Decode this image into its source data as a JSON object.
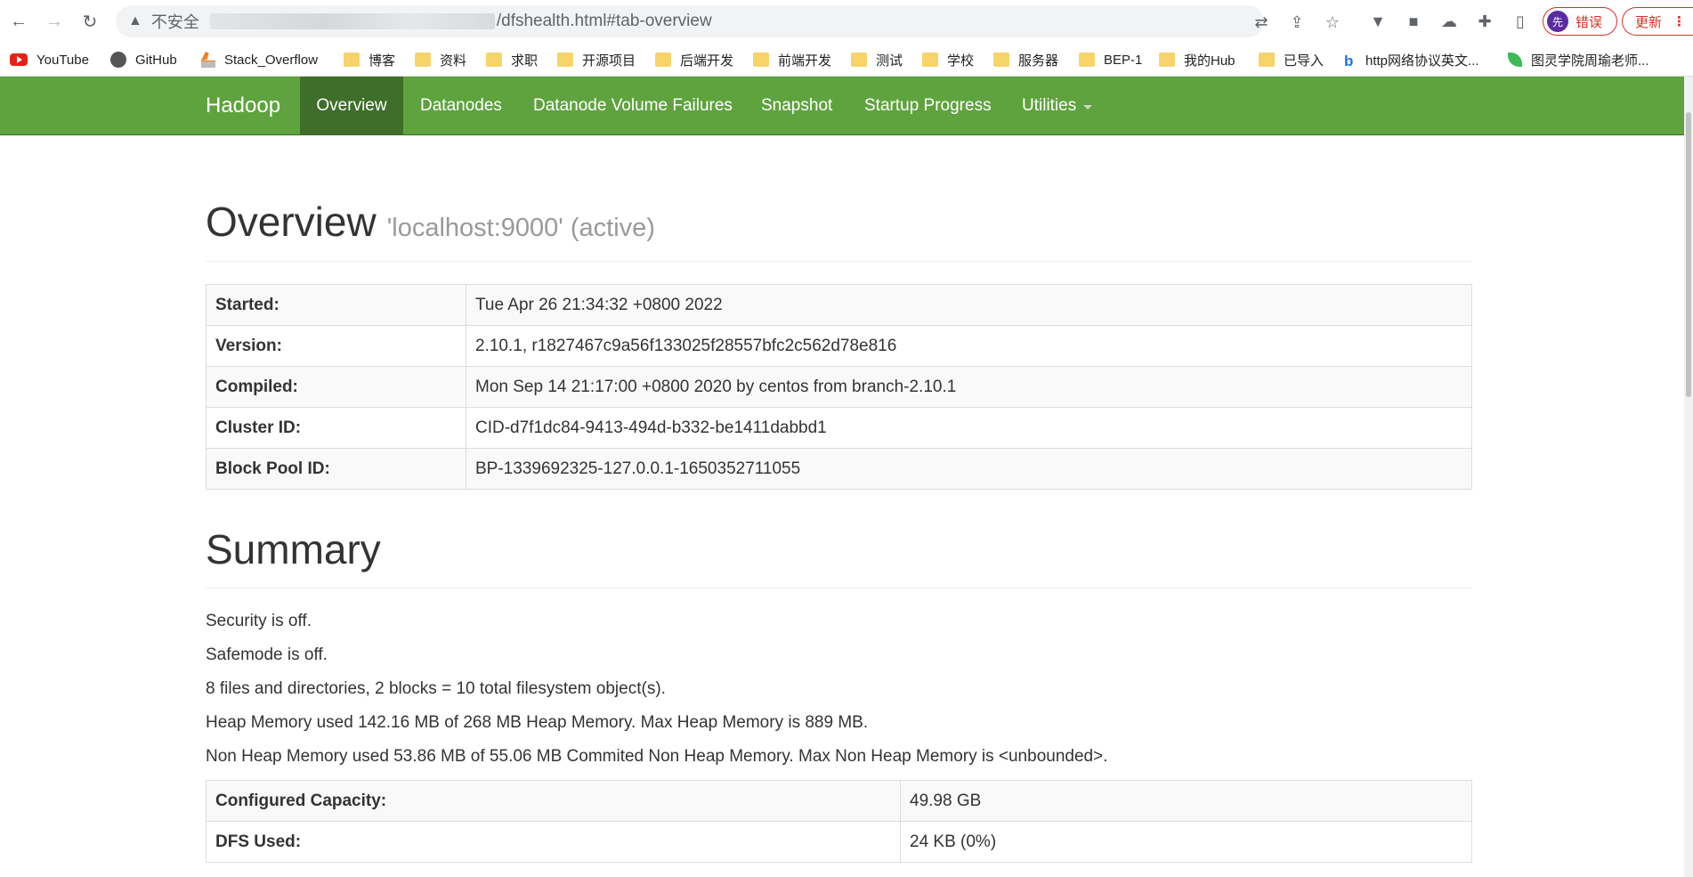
{
  "browser": {
    "security_label": "不安全",
    "url_path": "/dfshealth.html#tab-overview",
    "profile_status": "错误",
    "profile_avatar": "先",
    "update_label": "更新",
    "bookmarks": [
      {
        "label": "YouTube",
        "icon": "youtube-icon"
      },
      {
        "label": "GitHub",
        "icon": "github-icon"
      },
      {
        "label": "Stack_Overflow",
        "icon": "stackoverflow-icon"
      },
      {
        "label": "博客",
        "icon": "folder-icon"
      },
      {
        "label": "资料",
        "icon": "folder-icon"
      },
      {
        "label": "求职",
        "icon": "folder-icon"
      },
      {
        "label": "开源项目",
        "icon": "folder-icon"
      },
      {
        "label": "后端开发",
        "icon": "folder-icon"
      },
      {
        "label": "前端开发",
        "icon": "folder-icon"
      },
      {
        "label": "测试",
        "icon": "folder-icon"
      },
      {
        "label": "学校",
        "icon": "folder-icon"
      },
      {
        "label": "服务器",
        "icon": "folder-icon"
      },
      {
        "label": "BEP-1",
        "icon": "folder-icon"
      },
      {
        "label": "我的Hub",
        "icon": "folder-icon"
      },
      {
        "label": "已导入",
        "icon": "folder-icon"
      },
      {
        "label": "http网络协议英文...",
        "icon": "bing-icon"
      },
      {
        "label": "图灵学院周瑜老师...",
        "icon": "leaf-icon"
      }
    ]
  },
  "navbar": {
    "brand": "Hadoop",
    "items": [
      {
        "label": "Overview",
        "active": true
      },
      {
        "label": "Datanodes",
        "active": false
      },
      {
        "label": "Datanode Volume Failures",
        "active": false
      },
      {
        "label": "Snapshot",
        "active": false
      },
      {
        "label": "Startup Progress",
        "active": false
      },
      {
        "label": "Utilities",
        "active": false
      }
    ],
    "bg_color": "#5fa33e",
    "active_color": "#3e6e29"
  },
  "overview": {
    "title": "Overview",
    "subtitle": "'localhost:9000' (active)",
    "rows": [
      {
        "label": "Started:",
        "value": "Tue Apr 26 21:34:32 +0800 2022"
      },
      {
        "label": "Version:",
        "value": "2.10.1, r1827467c9a56f133025f28557bfc2c562d78e816"
      },
      {
        "label": "Compiled:",
        "value": "Mon Sep 14 21:17:00 +0800 2020 by centos from branch-2.10.1"
      },
      {
        "label": "Cluster ID:",
        "value": "CID-d7f1dc84-9413-494d-b332-be1411dabbd1"
      },
      {
        "label": "Block Pool ID:",
        "value": "BP-1339692325-127.0.0.1-1650352711055"
      }
    ]
  },
  "summary": {
    "title": "Summary",
    "lines": [
      "Security is off.",
      "Safemode is off.",
      "8 files and directories, 2 blocks = 10 total filesystem object(s).",
      "Heap Memory used 142.16 MB of 268 MB Heap Memory. Max Heap Memory is 889 MB.",
      "Non Heap Memory used 53.86 MB of 55.06 MB Commited Non Heap Memory. Max Non Heap Memory is <unbounded>."
    ],
    "rows": [
      {
        "label": "Configured Capacity:",
        "value": "49.98 GB"
      },
      {
        "label": "DFS Used:",
        "value": "24 KB (0%)"
      }
    ]
  }
}
